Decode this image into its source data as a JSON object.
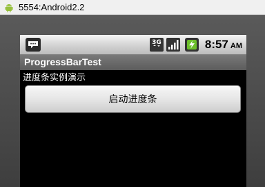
{
  "window": {
    "title": "5554:Android2.2"
  },
  "status_bar": {
    "time": "8:57",
    "ampm": "AM",
    "network_label": "3G",
    "icons": [
      "notification-icon",
      "3g-network-icon",
      "signal-strength-icon",
      "battery-charging-icon"
    ]
  },
  "app": {
    "title": "ProgressBarTest",
    "description": "进度条实例演示",
    "start_button_label": "启动进度条"
  },
  "colors": {
    "screen_background": "#000000",
    "title_bar": "#6b6b6b",
    "status_bar": "#d0d0d0",
    "button_background": "#e8e8e8"
  }
}
